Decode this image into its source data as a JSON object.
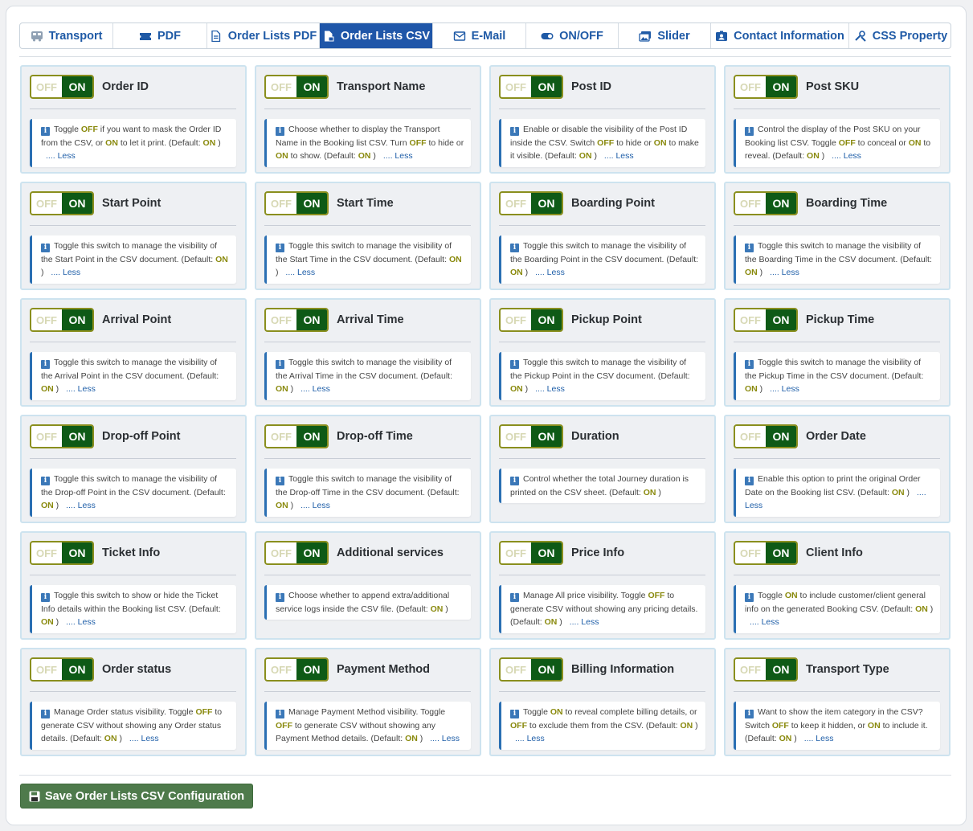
{
  "tabs": [
    {
      "label": "Transport",
      "icon": "bus-icon",
      "active": false
    },
    {
      "label": "PDF",
      "icon": "ticket-icon",
      "active": false
    },
    {
      "label": "Order Lists PDF",
      "icon": "pdf-file-icon",
      "active": false
    },
    {
      "label": "Order Lists CSV",
      "icon": "csv-file-icon",
      "active": true
    },
    {
      "label": "E-Mail",
      "icon": "envelope-icon",
      "active": false
    },
    {
      "label": "ON/OFF",
      "icon": "toggle-icon",
      "active": false
    },
    {
      "label": "Slider",
      "icon": "images-icon",
      "active": false
    },
    {
      "label": "Contact Information",
      "icon": "id-card-icon",
      "active": false
    },
    {
      "label": "CSS Property",
      "icon": "tools-icon",
      "active": false
    }
  ],
  "toggle": {
    "off_label": "OFF",
    "on_label": "ON"
  },
  "less_label": ".... Less",
  "cards": [
    {
      "title": "Order ID",
      "desc": [
        [
          "t",
          "Toggle "
        ],
        [
          "b",
          "OFF"
        ],
        [
          "t",
          " if you want to mask the Order ID from the CSV, or "
        ],
        [
          "b",
          "ON"
        ],
        [
          "t",
          " to let it print. (Default: "
        ],
        [
          "b",
          "ON"
        ],
        [
          "t",
          " )"
        ]
      ],
      "less": true
    },
    {
      "title": "Transport Name",
      "desc": [
        [
          "t",
          "Choose whether to display the Transport Name in the Booking list CSV. Turn "
        ],
        [
          "b",
          "OFF"
        ],
        [
          "t",
          " to hide or "
        ],
        [
          "b",
          "ON"
        ],
        [
          "t",
          " to show. (Default: "
        ],
        [
          "b",
          "ON"
        ],
        [
          "t",
          " )"
        ]
      ],
      "less": true
    },
    {
      "title": "Post ID",
      "desc": [
        [
          "t",
          "Enable or disable the visibility of the Post ID inside the CSV. Switch "
        ],
        [
          "b",
          "OFF"
        ],
        [
          "t",
          " to hide or "
        ],
        [
          "b",
          "ON"
        ],
        [
          "t",
          " to make it visible. (Default: "
        ],
        [
          "b",
          "ON"
        ],
        [
          "t",
          " )"
        ]
      ],
      "less": true
    },
    {
      "title": "Post SKU",
      "desc": [
        [
          "t",
          "Control the display of the Post SKU on your Booking list CSV. Toggle "
        ],
        [
          "b",
          "OFF"
        ],
        [
          "t",
          " to conceal or "
        ],
        [
          "b",
          "ON"
        ],
        [
          "t",
          " to reveal. (Default: "
        ],
        [
          "b",
          "ON"
        ],
        [
          "t",
          " )"
        ]
      ],
      "less": true
    },
    {
      "title": "Start Point",
      "desc": [
        [
          "t",
          "Toggle this switch to manage the visibility of the Start Point in the CSV document. (Default: "
        ],
        [
          "b",
          "ON"
        ],
        [
          "t",
          " )"
        ]
      ],
      "less": true
    },
    {
      "title": "Start Time",
      "desc": [
        [
          "t",
          "Toggle this switch to manage the visibility of the Start Time in the CSV document. (Default: "
        ],
        [
          "b",
          "ON"
        ],
        [
          "t",
          " )"
        ]
      ],
      "less": true
    },
    {
      "title": "Boarding Point",
      "desc": [
        [
          "t",
          "Toggle this switch to manage the visibility of the Boarding Point in the CSV document. (Default: "
        ],
        [
          "b",
          "ON"
        ],
        [
          "t",
          " )"
        ]
      ],
      "less": true
    },
    {
      "title": "Boarding Time",
      "desc": [
        [
          "t",
          "Toggle this switch to manage the visibility of the Boarding Time in the CSV document. (Default: "
        ],
        [
          "b",
          "ON"
        ],
        [
          "t",
          " )"
        ]
      ],
      "less": true
    },
    {
      "title": "Arrival Point",
      "desc": [
        [
          "t",
          "Toggle this switch to manage the visibility of the Arrival Point in the CSV document. (Default: "
        ],
        [
          "b",
          "ON"
        ],
        [
          "t",
          " )"
        ]
      ],
      "less": true
    },
    {
      "title": "Arrival Time",
      "desc": [
        [
          "t",
          "Toggle this switch to manage the visibility of the Arrival Time in the CSV document. (Default: "
        ],
        [
          "b",
          "ON"
        ],
        [
          "t",
          " )"
        ]
      ],
      "less": true
    },
    {
      "title": "Pickup Point",
      "desc": [
        [
          "t",
          "Toggle this switch to manage the visibility of the Pickup Point in the CSV document. (Default: "
        ],
        [
          "b",
          "ON"
        ],
        [
          "t",
          " )"
        ]
      ],
      "less": true
    },
    {
      "title": "Pickup Time",
      "desc": [
        [
          "t",
          "Toggle this switch to manage the visibility of the Pickup Time in the CSV document. (Default: "
        ],
        [
          "b",
          "ON"
        ],
        [
          "t",
          " )"
        ]
      ],
      "less": true
    },
    {
      "title": "Drop-off Point",
      "desc": [
        [
          "t",
          "Toggle this switch to manage the visibility of the Drop-off Point in the CSV document. (Default: "
        ],
        [
          "b",
          "ON"
        ],
        [
          "t",
          " )"
        ]
      ],
      "less": true
    },
    {
      "title": "Drop-off Time",
      "desc": [
        [
          "t",
          "Toggle this switch to manage the visibility of the Drop-off Time in the CSV document. (Default: "
        ],
        [
          "b",
          "ON"
        ],
        [
          "t",
          " )"
        ]
      ],
      "less": true
    },
    {
      "title": "Duration",
      "desc": [
        [
          "t",
          "Control whether the total Journey duration is printed on the CSV sheet. (Default: "
        ],
        [
          "b",
          "ON"
        ],
        [
          "t",
          " )"
        ]
      ],
      "less": false
    },
    {
      "title": "Order Date",
      "desc": [
        [
          "t",
          "Enable this option to print the original Order Date on the Booking list CSV. (Default: "
        ],
        [
          "b",
          "ON"
        ],
        [
          "t",
          " )"
        ]
      ],
      "less": true
    },
    {
      "title": "Ticket Info",
      "desc": [
        [
          "t",
          "Toggle this switch to show or hide the Ticket Info details within the Booking list CSV. (Default: "
        ],
        [
          "b",
          "ON"
        ],
        [
          "t",
          " )"
        ]
      ],
      "less": true
    },
    {
      "title": "Additional services",
      "desc": [
        [
          "t",
          "Choose whether to append extra/additional service logs inside the CSV file. (Default: "
        ],
        [
          "b",
          "ON"
        ],
        [
          "t",
          " )"
        ]
      ],
      "less": false
    },
    {
      "title": "Price Info",
      "desc": [
        [
          "t",
          "Manage All price visibility. Toggle "
        ],
        [
          "b",
          "OFF"
        ],
        [
          "t",
          " to generate CSV without showing any pricing details. (Default: "
        ],
        [
          "b",
          "ON"
        ],
        [
          "t",
          " )"
        ]
      ],
      "less": true
    },
    {
      "title": "Client Info",
      "desc": [
        [
          "t",
          "Toggle "
        ],
        [
          "b",
          "ON"
        ],
        [
          "t",
          " to include customer/client general info on the generated Booking CSV. (Default: "
        ],
        [
          "b",
          "ON"
        ],
        [
          "t",
          " )"
        ]
      ],
      "less": true
    },
    {
      "title": "Order status",
      "desc": [
        [
          "t",
          "Manage Order status visibility. Toggle "
        ],
        [
          "b",
          "OFF"
        ],
        [
          "t",
          " to generate CSV without showing any Order status details. (Default: "
        ],
        [
          "b",
          "ON"
        ],
        [
          "t",
          " )"
        ]
      ],
      "less": true
    },
    {
      "title": "Payment Method",
      "desc": [
        [
          "t",
          "Manage Payment Method visibility. Toggle "
        ],
        [
          "b",
          "OFF"
        ],
        [
          "t",
          " to generate CSV without showing any Payment Method details. (Default: "
        ],
        [
          "b",
          "ON"
        ],
        [
          "t",
          " )"
        ]
      ],
      "less": true
    },
    {
      "title": "Billing Information",
      "desc": [
        [
          "t",
          "Toggle "
        ],
        [
          "b",
          "ON"
        ],
        [
          "t",
          " to reveal complete billing details, or "
        ],
        [
          "b",
          "OFF"
        ],
        [
          "t",
          " to exclude them from the CSV. (Default: "
        ],
        [
          "b",
          "ON"
        ],
        [
          "t",
          " )"
        ]
      ],
      "less": true
    },
    {
      "title": "Transport Type",
      "desc": [
        [
          "t",
          "Want to show the item category in the CSV? Switch "
        ],
        [
          "b",
          "OFF"
        ],
        [
          "t",
          " to keep it hidden, or "
        ],
        [
          "b",
          "ON"
        ],
        [
          "t",
          " to include it. (Default: "
        ],
        [
          "b",
          "ON"
        ],
        [
          "t",
          " )"
        ]
      ],
      "less": true
    }
  ],
  "save_button": {
    "label": "Save Order Lists CSV Configuration",
    "icon": "floppy-disk-icon"
  },
  "colors": {
    "active_tab": "#1f56a8",
    "tab_text": "#1f5aa6",
    "toggle_on": "#0e5a16",
    "highlight": "#8a8a0e",
    "save_button": "#4e7a4b"
  }
}
